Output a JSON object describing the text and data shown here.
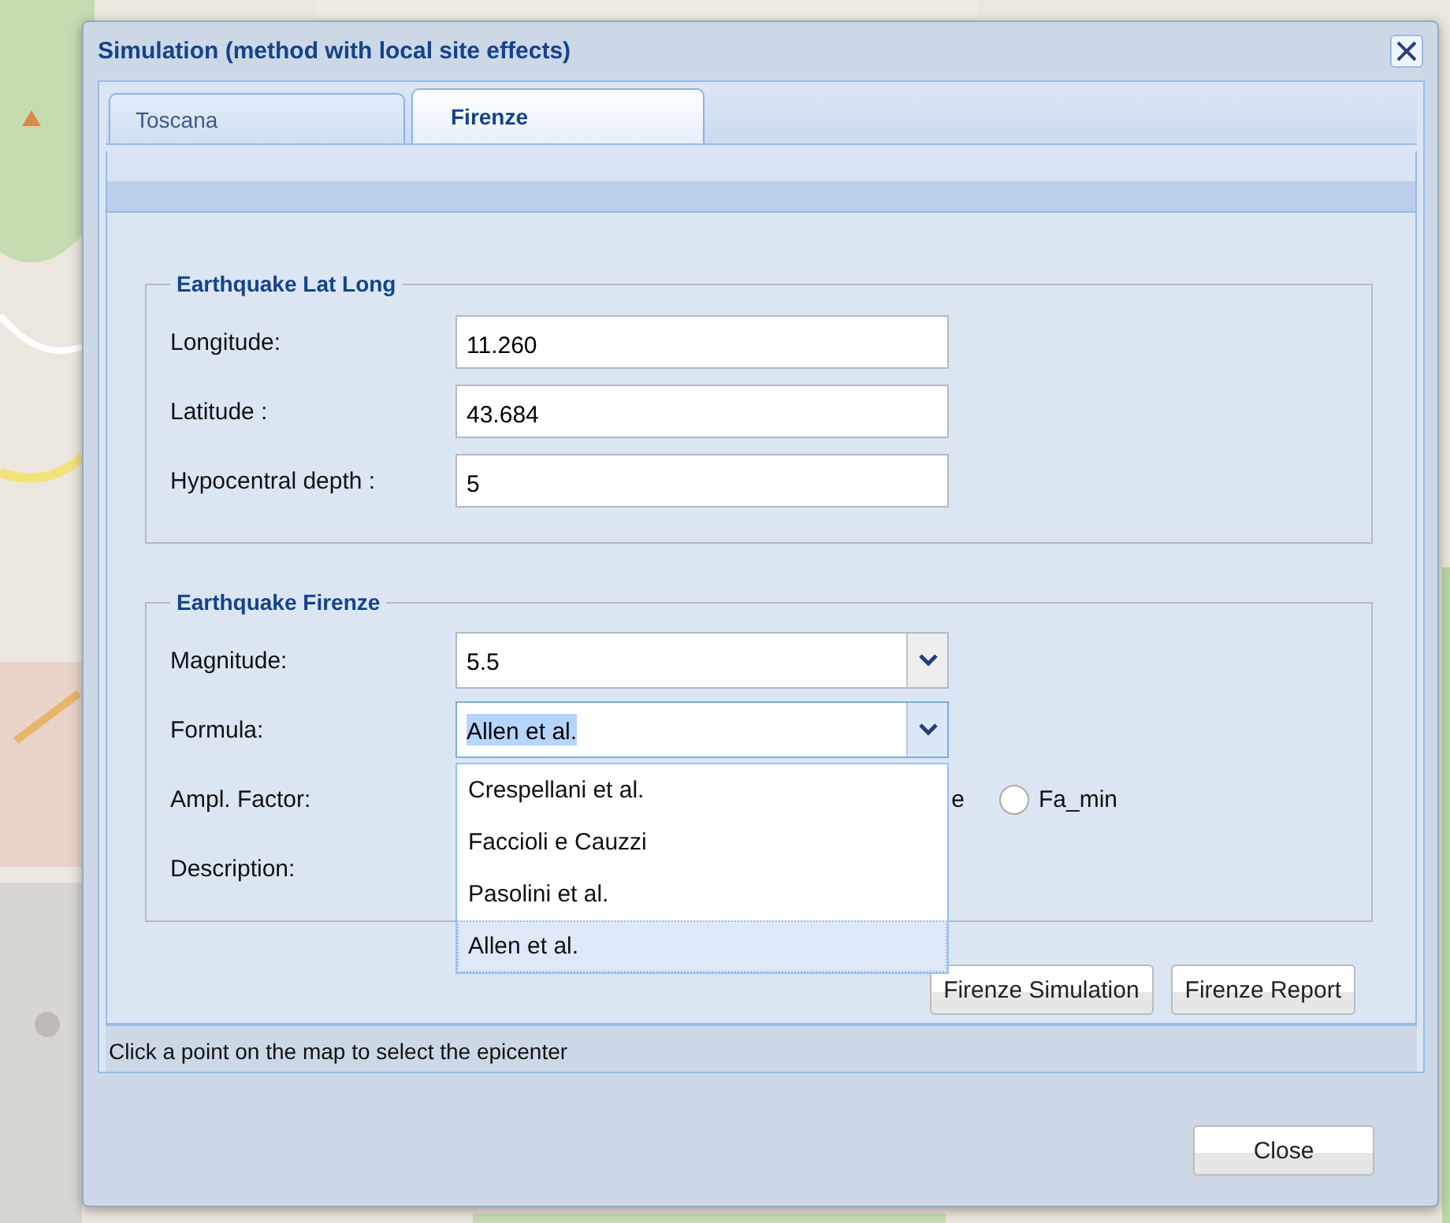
{
  "window": {
    "title": "Simulation (method with local site effects)"
  },
  "tabs": [
    {
      "label": "Toscana",
      "selected": false
    },
    {
      "label": "Firenze",
      "selected": true
    }
  ],
  "lat_long": {
    "legend": "Earthquake Lat Long",
    "fields": [
      {
        "label": "Longitude:",
        "value": "11.260"
      },
      {
        "label": "Latitude :",
        "value": "43.684"
      },
      {
        "label": "Hypocentral depth :",
        "value": "5"
      }
    ]
  },
  "firenze": {
    "legend": "Earthquake Firenze",
    "magnitude": {
      "label": "Magnitude:",
      "value": "5.5",
      "focused": false,
      "highlighted": false
    },
    "formula": {
      "label": "Formula:",
      "value": "Allen et al.",
      "focused": true,
      "highlighted": true,
      "options": [
        {
          "label": "Crespellani et al.",
          "selected": false
        },
        {
          "label": "Faccioli e Cauzzi",
          "selected": false
        },
        {
          "label": "Pasolini et al.",
          "selected": false
        },
        {
          "label": "Allen et al.",
          "selected": true
        }
      ]
    },
    "ampl_factor": {
      "label": "Ampl. Factor:",
      "options": [
        {
          "kind": "cut",
          "label": "e"
        },
        {
          "kind": "radio",
          "label": "Fa_min",
          "selected": false
        }
      ]
    },
    "description": {
      "label": "Description:"
    }
  },
  "buttons": [
    "Firenze Simulation",
    "Firenze Report"
  ],
  "status": "Click a point on the map to select the epicenter",
  "close_button": "Close"
}
